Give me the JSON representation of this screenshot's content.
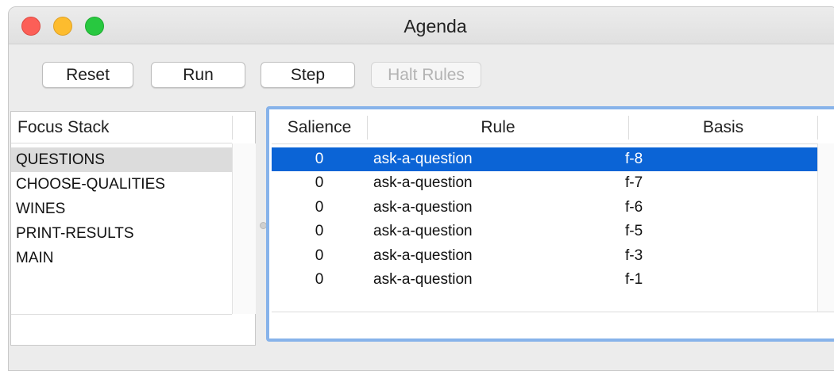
{
  "window": {
    "title": "Agenda"
  },
  "toolbar": {
    "reset_label": "Reset",
    "run_label": "Run",
    "step_label": "Step",
    "halt_label": "Halt Rules"
  },
  "focus_stack": {
    "header": "Focus Stack",
    "items": [
      "QUESTIONS",
      "CHOOSE-QUALITIES",
      "WINES",
      "PRINT-RESULTS",
      "MAIN"
    ],
    "selected_index": 0
  },
  "agenda": {
    "columns": [
      "Salience",
      "Rule",
      "Basis"
    ],
    "rows": [
      {
        "salience": "0",
        "rule": "ask-a-question",
        "basis": "f-8"
      },
      {
        "salience": "0",
        "rule": "ask-a-question",
        "basis": "f-7"
      },
      {
        "salience": "0",
        "rule": "ask-a-question",
        "basis": "f-6"
      },
      {
        "salience": "0",
        "rule": "ask-a-question",
        "basis": "f-5"
      },
      {
        "salience": "0",
        "rule": "ask-a-question",
        "basis": "f-3"
      },
      {
        "salience": "0",
        "rule": "ask-a-question",
        "basis": "f-1"
      }
    ],
    "selected_index": 0
  },
  "colors": {
    "selection_blue": "#0b64d6",
    "focus_ring": "#87b3ea",
    "close": "#fc5f57",
    "minimize": "#fdbc2e",
    "maximize": "#28c840"
  }
}
